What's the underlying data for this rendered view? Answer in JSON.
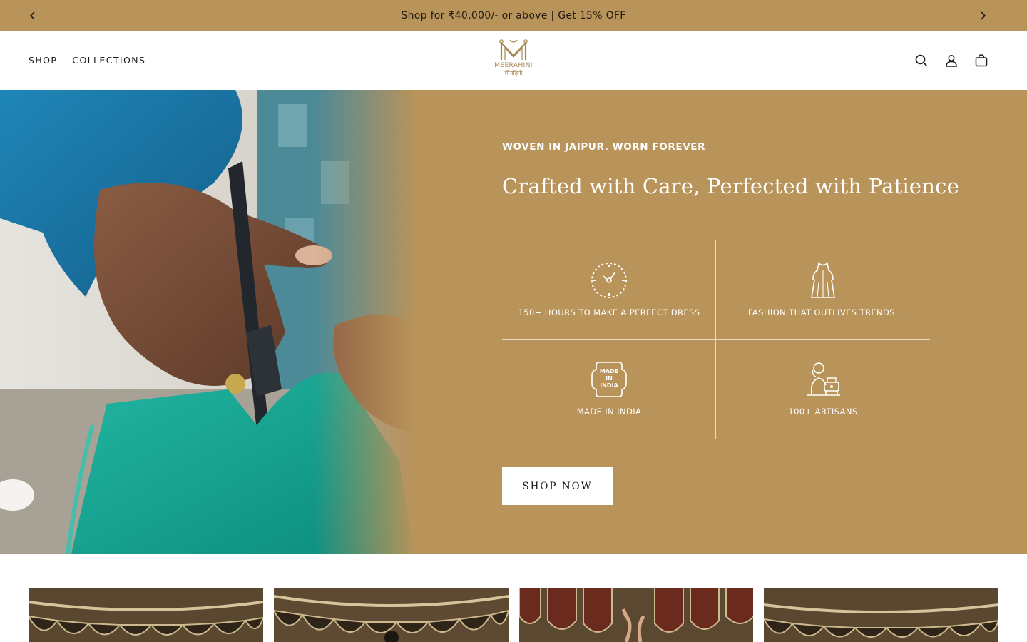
{
  "announcement": {
    "text": "Shop for ₹40,000/- or above | Get 15% OFF",
    "prev_icon": "chevron-left-icon",
    "next_icon": "chevron-right-icon"
  },
  "header": {
    "nav": [
      {
        "label": "SHOP"
      },
      {
        "label": "COLLECTIONS"
      }
    ],
    "logo": {
      "word": "MEERAHINI",
      "hindi": "मीराहिनी"
    },
    "icons": [
      "search-icon",
      "account-icon",
      "cart-icon"
    ]
  },
  "hero": {
    "eyebrow": "WOVEN IN JAIPUR. WORN FOREVER",
    "title": "Crafted with Care, Perfected with Patience",
    "features": [
      {
        "label": "150+ HOURS TO MAKE A PERFECT DRESS",
        "icon": "clock-icon"
      },
      {
        "label": "FASHION THAT OUTLIVES TRENDS.",
        "icon": "dress-icon"
      },
      {
        "label": "MADE IN INDIA",
        "icon": "made-in-india-badge-icon",
        "badge_text": [
          "MADE",
          "IN",
          "INDIA"
        ]
      },
      {
        "label": "100+ ARTISANS",
        "icon": "artisan-icon"
      }
    ],
    "cta": "SHOP NOW"
  },
  "colors": {
    "brand_gold": "#b8935a",
    "logo_gold": "#a88650",
    "button_bg": "#ffffff"
  }
}
